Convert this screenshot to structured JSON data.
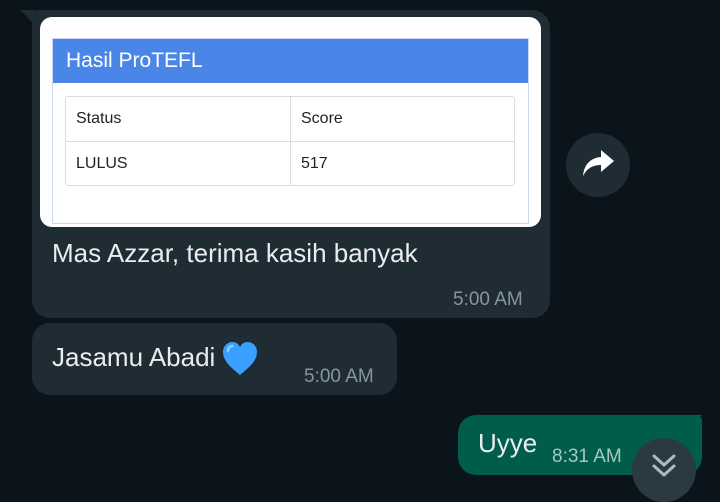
{
  "messages": [
    {
      "image": {
        "panel_title": "Hasil ProTEFL",
        "table": {
          "headers": [
            "Status",
            "Score"
          ],
          "rows": [
            [
              "LULUS",
              "517"
            ]
          ]
        }
      },
      "text": "Mas Azzar, terima kasih banyak",
      "time": "5:00 AM"
    },
    {
      "text": "Jasamu Abadi",
      "emoji": "blue-heart",
      "time": "5:00 AM"
    },
    {
      "text": "Uyye",
      "time": "8:31 AM"
    }
  ],
  "colors": {
    "background": "#0b141a",
    "incoming_bubble": "#202c33",
    "outgoing_bubble": "#005c4b",
    "panel_header": "#4a86e8",
    "heart": "#3aa0ff",
    "timestamp": "#8696a0"
  },
  "icons": {
    "forward": "forward-arrow-icon",
    "scroll_down": "double-chevron-down-icon"
  }
}
